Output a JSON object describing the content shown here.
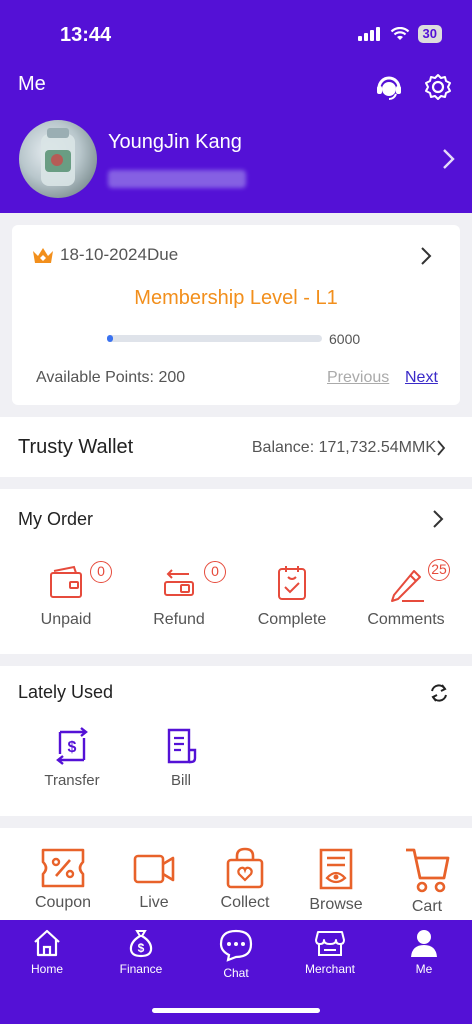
{
  "status": {
    "time": "13:44",
    "battery": "30"
  },
  "header": {
    "title": "Me"
  },
  "profile": {
    "name": "YoungJin Kang"
  },
  "membership": {
    "due": "18-10-2024Due",
    "level": "Membership Level - L1",
    "progress_max": "6000",
    "progress_fraction": 0.0,
    "points": "Available Points: 200",
    "previous": "Previous",
    "next": "Next"
  },
  "wallet": {
    "title": "Trusty Wallet",
    "balance": "Balance: 171,732.54MMK"
  },
  "order": {
    "title": "My Order",
    "items": [
      {
        "label": "Unpaid",
        "count": "0",
        "icon": "wallet-icon"
      },
      {
        "label": "Refund",
        "count": "0",
        "icon": "refund-icon"
      },
      {
        "label": "Complete",
        "icon": "clipboard-check-icon"
      },
      {
        "label": "Comments",
        "count": "25",
        "icon": "pencil-icon"
      }
    ]
  },
  "lately": {
    "title": "Lately Used",
    "items": [
      {
        "label": "Transfer",
        "icon": "transfer-icon"
      },
      {
        "label": "Bill",
        "icon": "bill-icon"
      }
    ]
  },
  "tools": [
    {
      "label": "Coupon",
      "icon": "coupon-icon"
    },
    {
      "label": "Live",
      "icon": "video-icon"
    },
    {
      "label": "Collect",
      "icon": "bag-heart-icon"
    },
    {
      "label": "Browse",
      "icon": "browse-icon"
    },
    {
      "label": "Cart",
      "icon": "cart-icon"
    }
  ],
  "tabs": [
    {
      "label": "Home",
      "icon": "home-icon"
    },
    {
      "label": "Finance",
      "icon": "money-bag-icon"
    },
    {
      "label": "Chat",
      "icon": "chat-icon"
    },
    {
      "label": "Merchant",
      "icon": "store-icon"
    },
    {
      "label": "Me",
      "icon": "person-icon",
      "active": true
    }
  ],
  "colors": {
    "brand": "#5411d6",
    "accent_orange": "#f28f1c",
    "order_red": "#e64b3c",
    "tool_orange": "#e8622a",
    "link_blue": "#3a2ac8"
  }
}
